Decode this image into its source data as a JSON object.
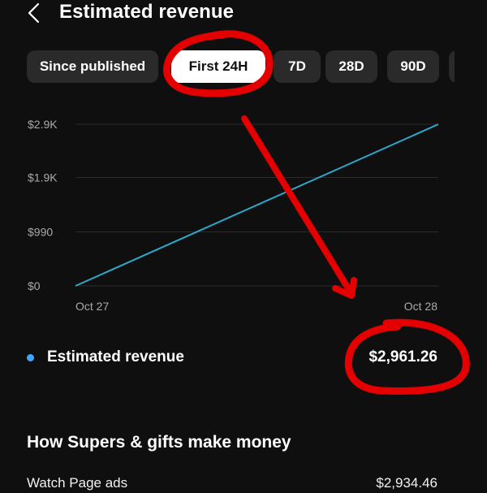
{
  "header": {
    "title": "Estimated revenue"
  },
  "chips": [
    "Since published",
    "First 24H",
    "7D",
    "28D",
    "90D"
  ],
  "selected_chip": "First 24H",
  "chart_data": {
    "type": "line",
    "x_ticks": [
      "Oct 27",
      "Oct 28"
    ],
    "y_ticks": [
      "$0",
      "$990",
      "$1.9K",
      "$2.9K"
    ],
    "series": [
      {
        "values": [
          0,
          2961.26
        ]
      }
    ],
    "line_color": "#2ea8c9"
  },
  "legend": {
    "label": "Estimated revenue",
    "value": "$2,961.26",
    "dot_color": "#3ea6ff"
  },
  "section": {
    "title": "How Supers & gifts make money"
  },
  "rows": [
    {
      "label": "Watch Page ads",
      "value": "$2,934.46"
    }
  ],
  "annotations": {
    "color": "#e40000"
  }
}
